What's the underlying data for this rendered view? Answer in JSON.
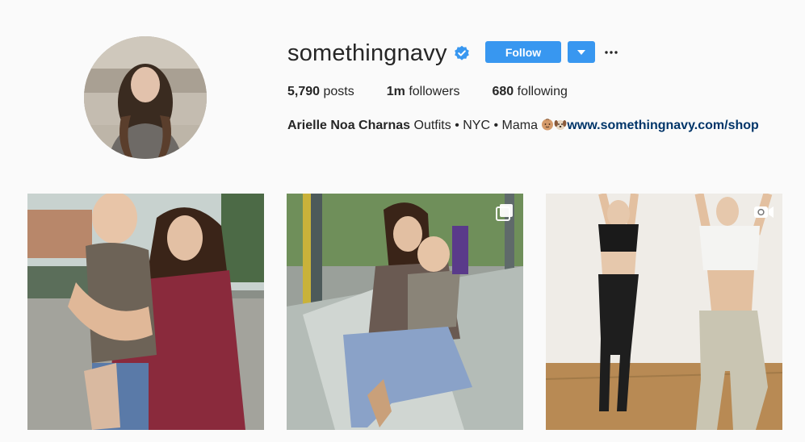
{
  "profile": {
    "username": "somethingnavy",
    "verified": true,
    "follow_label": "Follow",
    "more_label": "•••",
    "stats": {
      "posts_count": "5,790",
      "posts_label": "posts",
      "followers_count": "1m",
      "followers_label": "followers",
      "following_count": "680",
      "following_label": "following"
    },
    "bio": {
      "full_name": "Arielle Noa Charnas",
      "text": "Outfits • NYC • Mama",
      "emojis": [
        "baby-face-emoji",
        "puppy-emoji"
      ],
      "link": "www.somethingnavy.com/shop"
    }
  },
  "posts": [
    {
      "type": "photo",
      "description_icon": "none"
    },
    {
      "type": "carousel",
      "badge_icon": "carousel-icon"
    },
    {
      "type": "video",
      "badge_icon": "video-icon"
    }
  ],
  "colors": {
    "accent": "#3897f0",
    "link": "#003569",
    "text": "#262626",
    "background": "#fafafa"
  }
}
